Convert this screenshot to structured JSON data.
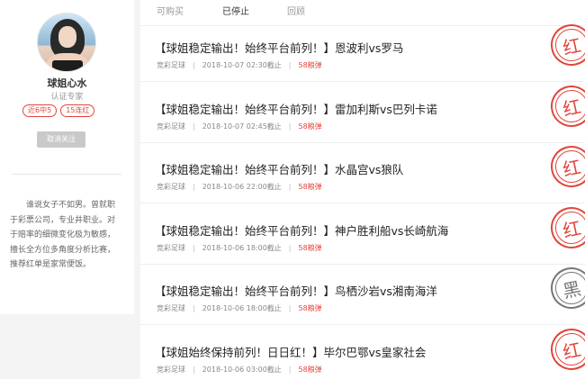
{
  "profile": {
    "name": "球姐心水",
    "title": "认证专家",
    "badges": [
      "近6中5",
      "15连红"
    ],
    "follow_label": "取消关注",
    "bio": "谁说女子不如男。曾就职于彩票公司，专业井职业。对于赔率的细微变化极为敏感，擅长全方位多角度分析比赛，推荐红单是家常便饭。"
  },
  "tabs": [
    "可购买",
    "已停止",
    "回顾"
  ],
  "active_tab": "已停止",
  "items": [
    {
      "title": "【球姐稳定输出！始终平台前列！】恩波利vs罗马",
      "category": "竞彩足球",
      "deadline": "2018-10-07 02:30截止",
      "price": "58粮弹",
      "stamp": "红"
    },
    {
      "title": "【球姐稳定输出！始终平台前列！】雷加利斯vs巴列卡诺",
      "category": "竞彩足球",
      "deadline": "2018-10-07 02:45截止",
      "price": "58粮弹",
      "stamp": "红"
    },
    {
      "title": "【球姐稳定输出！始终平台前列！】水晶宫vs狼队",
      "category": "竞彩足球",
      "deadline": "2018-10-06 22:00截止",
      "price": "58粮弹",
      "stamp": "红"
    },
    {
      "title": "【球姐稳定输出！始终平台前列！】神户胜利船vs长崎航海",
      "category": "竞彩足球",
      "deadline": "2018-10-06 18:00截止",
      "price": "58粮弹",
      "stamp": "红"
    },
    {
      "title": "【球姐稳定输出！始终平台前列！】鸟栖沙岩vs湘南海洋",
      "category": "竞彩足球",
      "deadline": "2018-10-06 18:00截止",
      "price": "58粮弹",
      "stamp": "黑"
    },
    {
      "title": "【球姐始终保持前列！日日红！】毕尔巴鄂vs皇家社会",
      "category": "竞彩足球",
      "deadline": "2018-10-06 03:00截止",
      "price": "58粮弹",
      "stamp": "红"
    }
  ],
  "colors": {
    "accent": "#e0463c",
    "lose": "#777777"
  }
}
